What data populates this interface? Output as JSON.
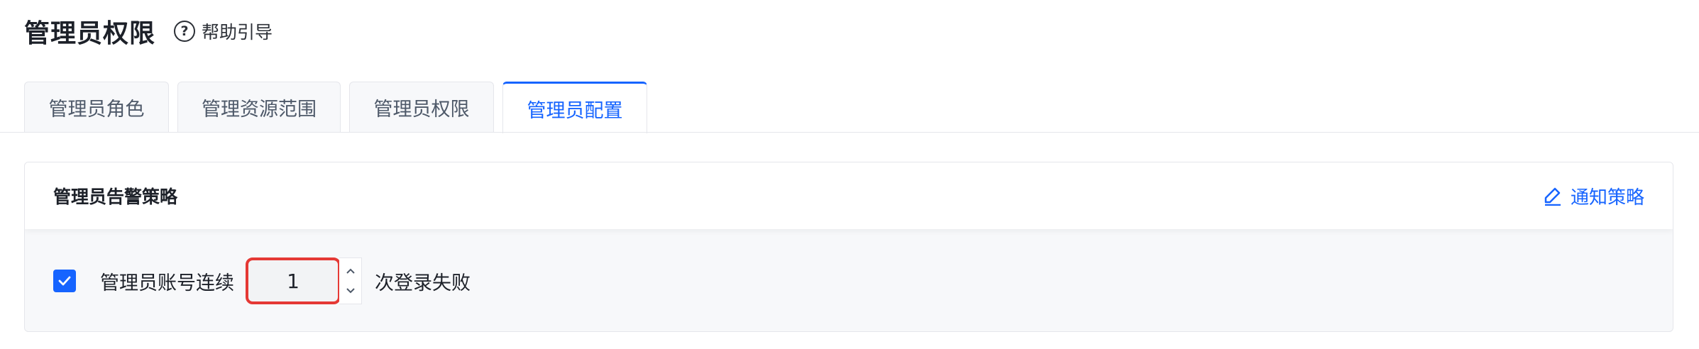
{
  "header": {
    "title": "管理员权限",
    "help_label": "帮助引导",
    "help_icon": "question-circle-icon"
  },
  "tabs": [
    {
      "label": "管理员角色",
      "active": false
    },
    {
      "label": "管理资源范围",
      "active": false
    },
    {
      "label": "管理员权限",
      "active": false
    },
    {
      "label": "管理员配置",
      "active": true
    }
  ],
  "card": {
    "title": "管理员告警策略",
    "action_label": "通知策略",
    "action_icon": "edit-icon",
    "rule": {
      "checked": true,
      "prefix": "管理员账号连续",
      "value": "1",
      "suffix": "次登录失败"
    }
  },
  "colors": {
    "accent": "#1664ff",
    "highlight_border": "#e53935",
    "text": "#1d2129",
    "muted": "#4e5969"
  }
}
